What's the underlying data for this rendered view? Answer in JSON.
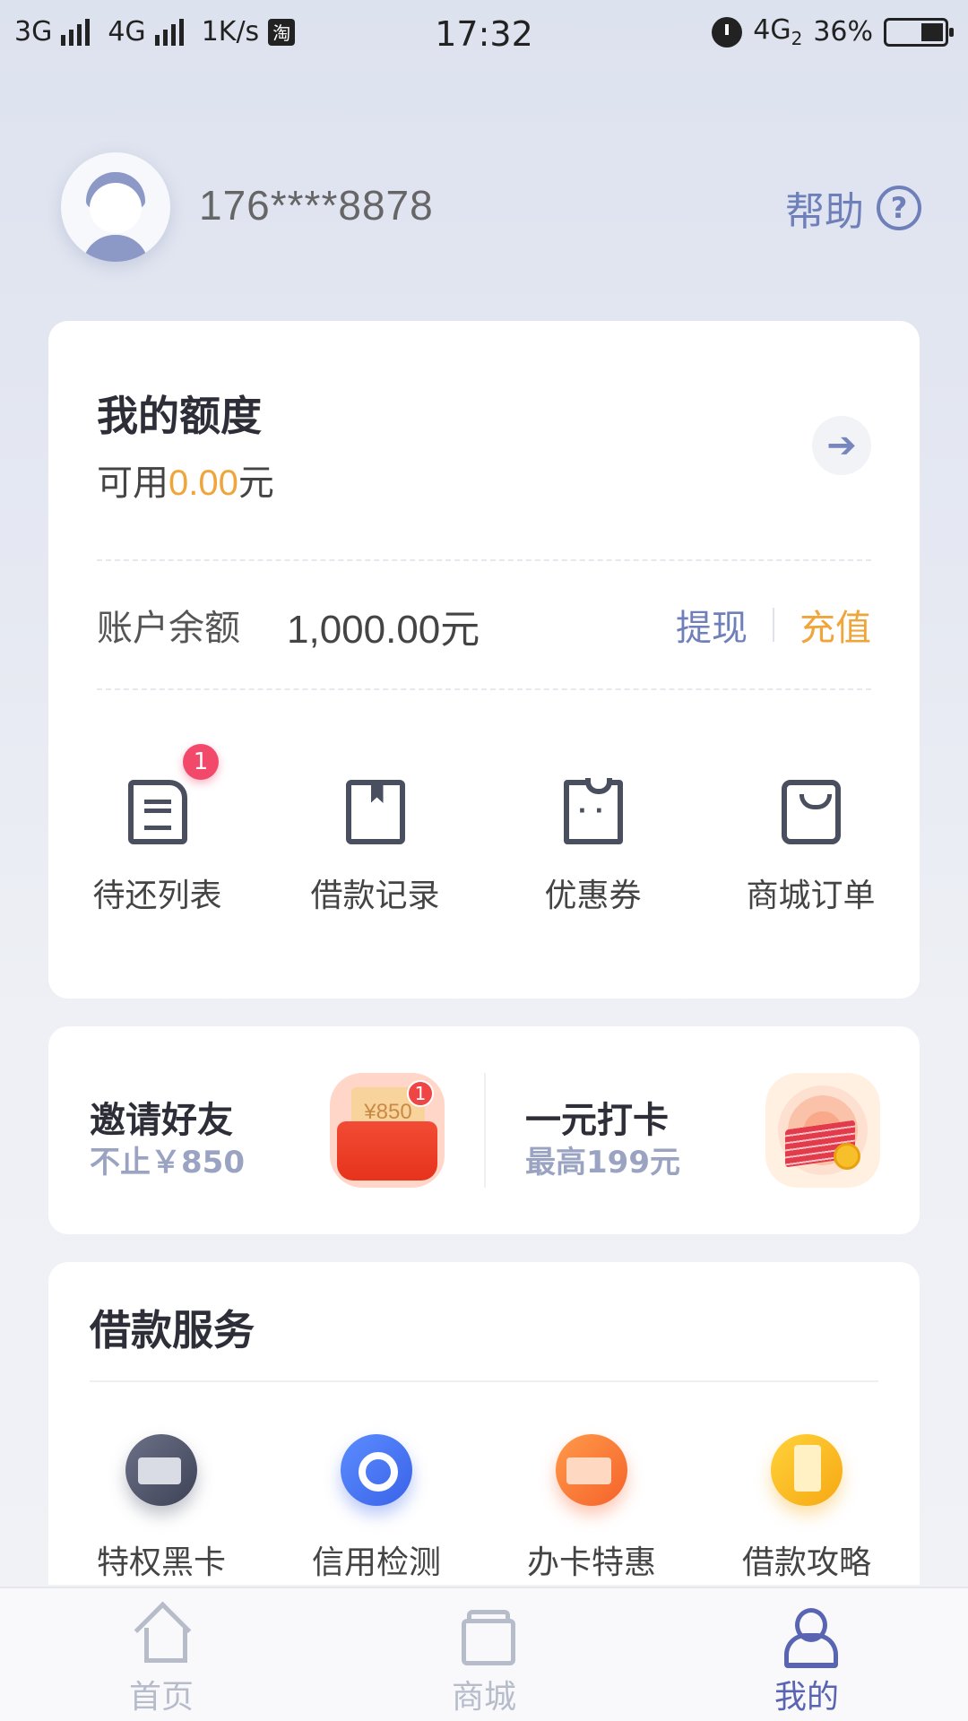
{
  "status_bar": {
    "net1": "3G",
    "net2": "4G",
    "speed": "1K/s",
    "taobao": "淘",
    "time": "17:32",
    "net3": "4G",
    "net3_sub": "2",
    "battery": "36%"
  },
  "header": {
    "phone": "176****8878",
    "help_label": "帮助",
    "help_icon": "?"
  },
  "quota": {
    "title": "我的额度",
    "available_prefix": "可用",
    "available_amount": "0.00",
    "available_unit": "元",
    "arrow": "➔",
    "balance_label": "账户余额",
    "balance_value": "1,000.00元",
    "withdraw": "提现",
    "recharge": "充值"
  },
  "shortcuts": [
    {
      "label": "待还列表",
      "icon": "document-list-icon",
      "badge": "1"
    },
    {
      "label": "借款记录",
      "icon": "bookmark-book-icon"
    },
    {
      "label": "优惠券",
      "icon": "ticket-icon"
    },
    {
      "label": "商城订单",
      "icon": "shopping-bag-icon"
    }
  ],
  "promos": [
    {
      "title": "邀请好友",
      "subtitle": "不止￥850",
      "image": "red-envelope-icon",
      "image_text": "¥850",
      "image_badge": "1"
    },
    {
      "title": "一元打卡",
      "subtitle": "最高199元",
      "image": "money-stack-icon"
    }
  ],
  "services": {
    "title": "借款服务",
    "items": [
      {
        "label": "特权黑卡",
        "icon": "black-card-icon",
        "color": "#4b4f66"
      },
      {
        "label": "信用检测",
        "icon": "credit-check-icon",
        "color": "#3f6cf0"
      },
      {
        "label": "办卡特惠",
        "icon": "card-offer-icon",
        "color": "#f5702e"
      },
      {
        "label": "借款攻略",
        "icon": "loan-guide-icon",
        "color": "#f6b11a"
      }
    ]
  },
  "bottom_nav": [
    {
      "label": "首页",
      "icon": "home-icon",
      "active": false
    },
    {
      "label": "商城",
      "icon": "shop-icon",
      "active": false
    },
    {
      "label": "我的",
      "icon": "profile-icon",
      "active": true
    }
  ],
  "colors": {
    "accent": "#6e7fb9",
    "orange": "#f0a53b",
    "nav_active": "#5965b3",
    "badge": "#f2496b"
  }
}
